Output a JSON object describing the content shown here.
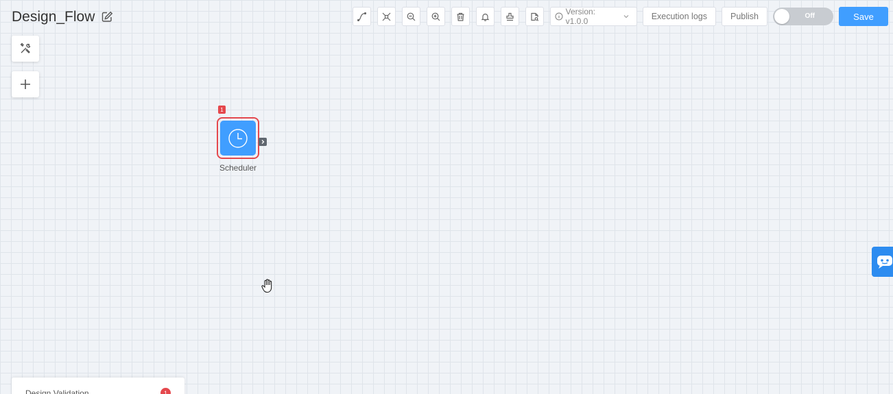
{
  "header": {
    "title": "Design_Flow"
  },
  "toolbar": {
    "icons": [
      "connector-icon",
      "fit-view-icon",
      "zoom-out-icon",
      "zoom-in-icon",
      "delete-icon",
      "notification-icon",
      "stamp-icon",
      "preview-icon"
    ],
    "version_label": "Version: v1.0.0",
    "execution_logs_label": "Execution logs",
    "publish_label": "Publish",
    "toggle_label": "Off",
    "save_label": "Save"
  },
  "canvas": {
    "nodes": [
      {
        "label": "Scheduler",
        "badge": "1",
        "icon": "clock-icon",
        "color": "#409eff",
        "error_border": "#e5484d"
      }
    ]
  },
  "validation": {
    "label": "Design Validation",
    "count": "1"
  },
  "colors": {
    "accent": "#409eff",
    "error": "#e5484d",
    "canvas_bg": "#f0f3f7",
    "grid": "#dfe4ea"
  }
}
